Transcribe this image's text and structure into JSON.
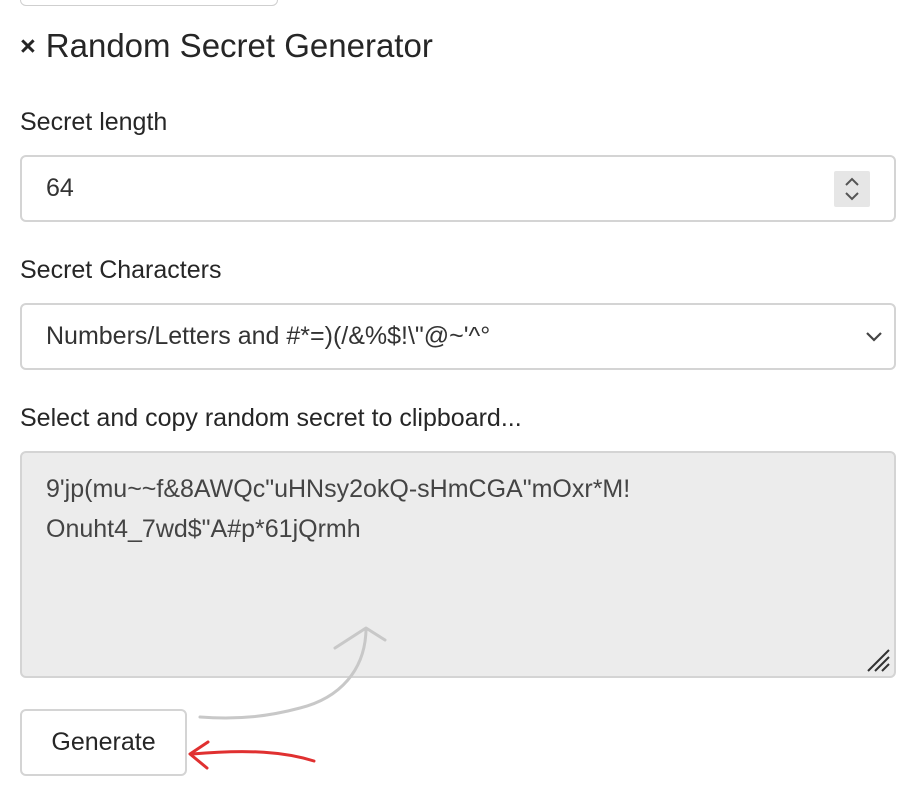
{
  "header": {
    "close_glyph": "×",
    "title": "Random Secret Generator"
  },
  "length": {
    "label": "Secret length",
    "value": "64"
  },
  "characters": {
    "label": "Secret Characters",
    "selected": "Numbers/Letters and #*=)(/&%$!\\\"@~'^°"
  },
  "secret": {
    "label": "Select and copy random secret to clipboard...",
    "line1": "9'jp(mu~~f&8AWQc\"uHNsy2okQ-sHmCGA\"mOxr*M!",
    "line2": "Onuht4_7wd$\"A#p*61jQrmh"
  },
  "actions": {
    "generate_label": "Generate"
  },
  "colors": {
    "annotation_red": "#e03030",
    "annotation_gray": "#c8c8c8"
  }
}
